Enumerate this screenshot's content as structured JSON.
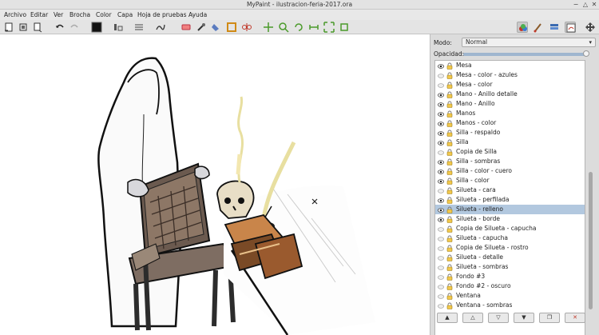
{
  "window": {
    "title": "MyPaint - ilustracion-feria-2017.ora"
  },
  "menubar": {
    "items": [
      {
        "label": "Archivo"
      },
      {
        "label": "Editar"
      },
      {
        "label": "Ver"
      },
      {
        "label": "Brocha"
      },
      {
        "label": "Color"
      },
      {
        "label": "Capa"
      },
      {
        "label": "Hoja de pruebas"
      },
      {
        "label": "Ayuda"
      }
    ]
  },
  "colors": {
    "foreground_color": "#111111",
    "selected_row": "#b2c8df",
    "accent": "#c0392b"
  },
  "layers_panel": {
    "mode_label": "Modo:",
    "mode_value": "Normal",
    "opacity_label": "Opacidad:",
    "opacity_value": 1.0,
    "layers": [
      {
        "name": "Mesa",
        "visible": true
      },
      {
        "name": "Mesa - color - azules",
        "visible": false
      },
      {
        "name": "Mesa - color",
        "visible": false
      },
      {
        "name": "Mano - Anillo detalle",
        "visible": true
      },
      {
        "name": "Mano - Anillo",
        "visible": true
      },
      {
        "name": "Manos",
        "visible": true
      },
      {
        "name": "Manos - color",
        "visible": true
      },
      {
        "name": "Silla - respaldo",
        "visible": true
      },
      {
        "name": "Silla",
        "visible": true
      },
      {
        "name": "Copia de Silla",
        "visible": false
      },
      {
        "name": "Silla - sombras",
        "visible": true
      },
      {
        "name": "Silla - color - cuero",
        "visible": true
      },
      {
        "name": "Silla - color",
        "visible": true
      },
      {
        "name": "Silueta - cara",
        "visible": false
      },
      {
        "name": "Silueta - perfilada",
        "visible": true
      },
      {
        "name": "Silueta - relleno",
        "visible": true,
        "selected": true
      },
      {
        "name": "Silueta - borde",
        "visible": true
      },
      {
        "name": "Copia de Silueta - capucha",
        "visible": false
      },
      {
        "name": "Silueta - capucha",
        "visible": false
      },
      {
        "name": "Copia de Silueta - rostro",
        "visible": false
      },
      {
        "name": "Silueta - detalle",
        "visible": false
      },
      {
        "name": "Silueta - sombras",
        "visible": false
      },
      {
        "name": "Fondo #3",
        "visible": false
      },
      {
        "name": "Fondo #2 - oscuro",
        "visible": false
      },
      {
        "name": "Ventana",
        "visible": false
      },
      {
        "name": "Ventana - sombras",
        "visible": false
      }
    ],
    "buttons": [
      {
        "icon": "arrow-up-icon"
      },
      {
        "icon": "triangle-up-icon"
      },
      {
        "icon": "triangle-down-icon"
      },
      {
        "icon": "arrow-down-icon"
      },
      {
        "icon": "duplicate-icon"
      },
      {
        "icon": "delete-icon"
      }
    ]
  }
}
